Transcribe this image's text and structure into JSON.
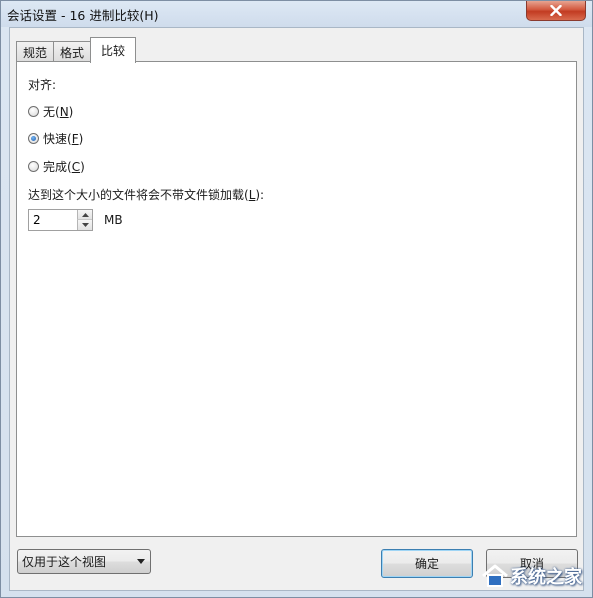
{
  "window": {
    "title": "会话设置 - 16 进制比较(H)"
  },
  "tabs": [
    {
      "label": "规范"
    },
    {
      "label": "格式"
    },
    {
      "label": "比较"
    }
  ],
  "alignment": {
    "label": "对齐:",
    "options": [
      {
        "text": "无(",
        "key": "N",
        "end": ")",
        "checked": false
      },
      {
        "text": "快速(",
        "key": "F",
        "end": ")",
        "checked": true
      },
      {
        "text": "完成(",
        "key": "C",
        "end": ")",
        "checked": false
      }
    ]
  },
  "file_size": {
    "label_prefix": "达到这个大小的文件将会不带文件锁加载(",
    "label_key": "L",
    "label_suffix": "):",
    "value": "2",
    "unit": "MB"
  },
  "footer": {
    "scope_selected": "仅用于这个视图",
    "ok_label": "确定",
    "cancel_label": "取消"
  },
  "watermark": {
    "text": "系统之家"
  }
}
